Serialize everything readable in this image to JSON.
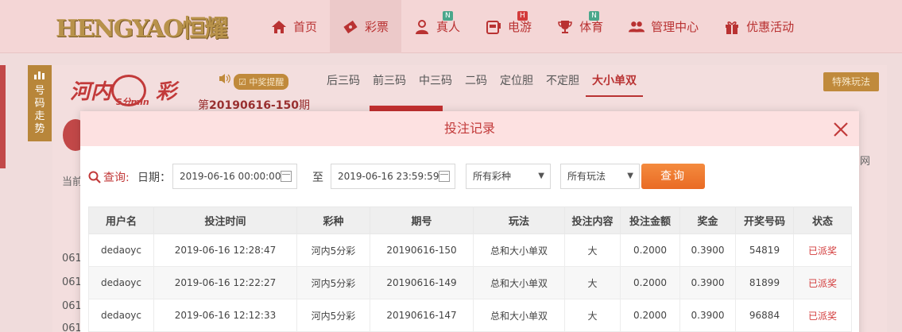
{
  "brand": {
    "logo_text": "HENGYAO恒耀"
  },
  "nav": [
    {
      "label": "首页",
      "icon": "home-icon",
      "badge": ""
    },
    {
      "label": "彩票",
      "icon": "ticket-icon",
      "badge": ""
    },
    {
      "label": "真人",
      "icon": "user-icon",
      "badge": "N"
    },
    {
      "label": "电游",
      "icon": "slot-machine-icon",
      "badge": "H"
    },
    {
      "label": "体育",
      "icon": "trophy-icon",
      "badge": "N"
    },
    {
      "label": "管理中心",
      "icon": "users-icon",
      "badge": ""
    },
    {
      "label": "优惠活动",
      "icon": "gift-icon",
      "badge": ""
    }
  ],
  "colors": {
    "accent": "#c23a3a",
    "gold": "#c08a3c",
    "badge_n": "#4aa78b",
    "badge_h": "#d33b3b"
  },
  "side_tab": "号码走势",
  "game": {
    "logo_text": "河内",
    "logo_suffix": "彩",
    "logo_sub": "5分min",
    "remind_label": "中奖提醒",
    "period_prefix": "第",
    "period_number": "20190616-150",
    "period_suffix": "期",
    "tabs": [
      "后三码",
      "前三码",
      "中三码",
      "二码",
      "定位胆",
      "不定胆",
      "大小单双"
    ],
    "special_label": "特殊玩法",
    "current_label": "当前",
    "right_cut": "网",
    "row_labels": [
      "061",
      "061",
      "061",
      "061"
    ]
  },
  "modal": {
    "title": "投注记录",
    "query_label": "查询:",
    "date_label": "日期：",
    "start_date": "2019-06-16 00:00:00",
    "to_label": "至",
    "end_date": "2019-06-16 23:59:59",
    "lottery_select": "所有彩种",
    "play_select": "所有玩法",
    "query_button": "查询",
    "columns": [
      "用户名",
      "投注时间",
      "彩种",
      "期号",
      "玩法",
      "投注内容",
      "投注金额",
      "奖金",
      "开奖号码",
      "状态"
    ],
    "rows": [
      [
        "dedaoyc",
        "2019-06-16 12:28:47",
        "河内5分彩",
        "20190616-150",
        "总和大小单双",
        "大",
        "0.2000",
        "0.3900",
        "54819",
        "已派奖"
      ],
      [
        "dedaoyc",
        "2019-06-16 12:22:27",
        "河内5分彩",
        "20190616-149",
        "总和大小单双",
        "大",
        "0.2000",
        "0.3900",
        "81899",
        "已派奖"
      ],
      [
        "dedaoyc",
        "2019-06-16 12:12:33",
        "河内5分彩",
        "20190616-147",
        "总和大小单双",
        "大",
        "0.2000",
        "0.3900",
        "96884",
        "已派奖"
      ]
    ]
  }
}
